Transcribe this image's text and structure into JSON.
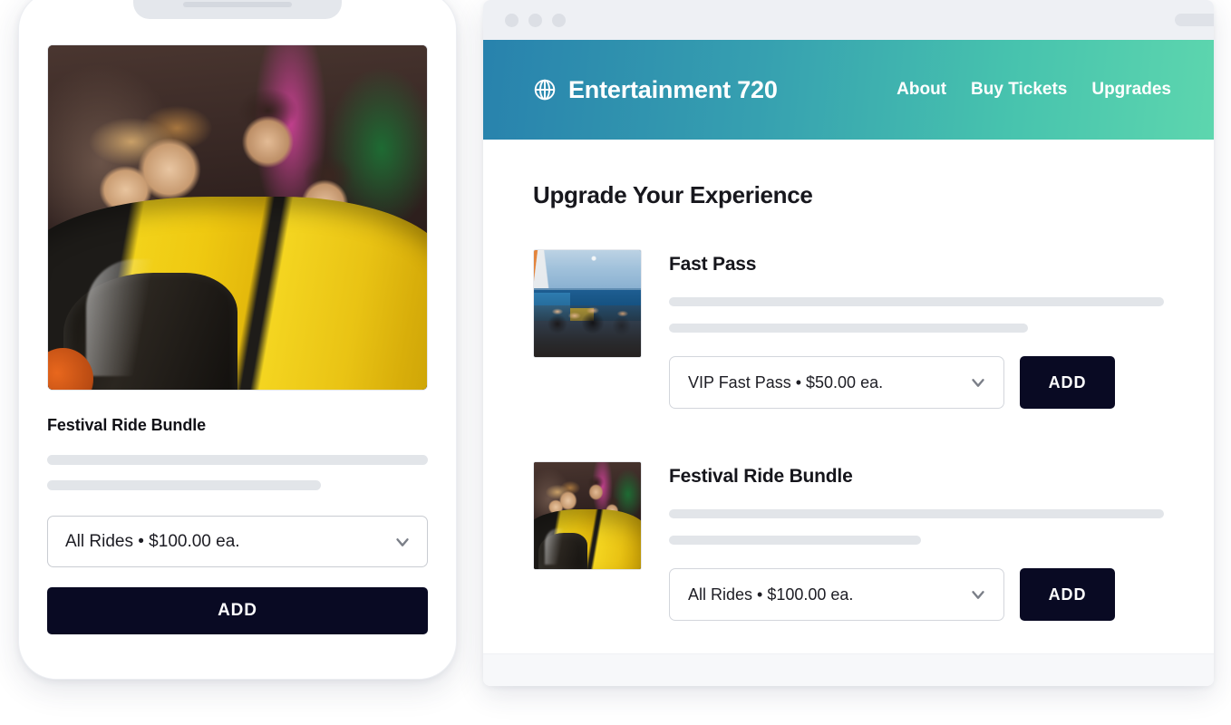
{
  "phone": {
    "hero_image_alt": "family riding yellow roller coaster",
    "product_title": "Festival Ride Bundle",
    "select_value": "All Rides  •  $100.00 ea.",
    "add_label": "ADD"
  },
  "browser": {
    "chrome": {
      "dots": [
        "close",
        "minimize",
        "maximize"
      ],
      "url_placeholder": ""
    },
    "header": {
      "brand_icon": "globe-icon",
      "brand_name": "Entertainment 720",
      "nav": [
        {
          "label": "About"
        },
        {
          "label": "Buy Tickets"
        },
        {
          "label": "Upgrades"
        }
      ],
      "gradient_from": "#2882ad",
      "gradient_to": "#5dd6ae"
    },
    "page_heading": "Upgrade Your Experience",
    "products": [
      {
        "thumb_alt": "crowd at amusement park pier",
        "title": "Fast Pass",
        "select_value": "VIP Fast Pass • $50.00 ea.",
        "add_label": "ADD"
      },
      {
        "thumb_alt": "family riding yellow roller coaster",
        "title": "Festival Ride Bundle",
        "select_value": "All Rides  •  $100.00 ea.",
        "add_label": "ADD"
      }
    ]
  },
  "colors": {
    "button_dark": "#090a23",
    "skeleton": "#e2e5e9",
    "chrome_bg": "#eef0f4"
  }
}
